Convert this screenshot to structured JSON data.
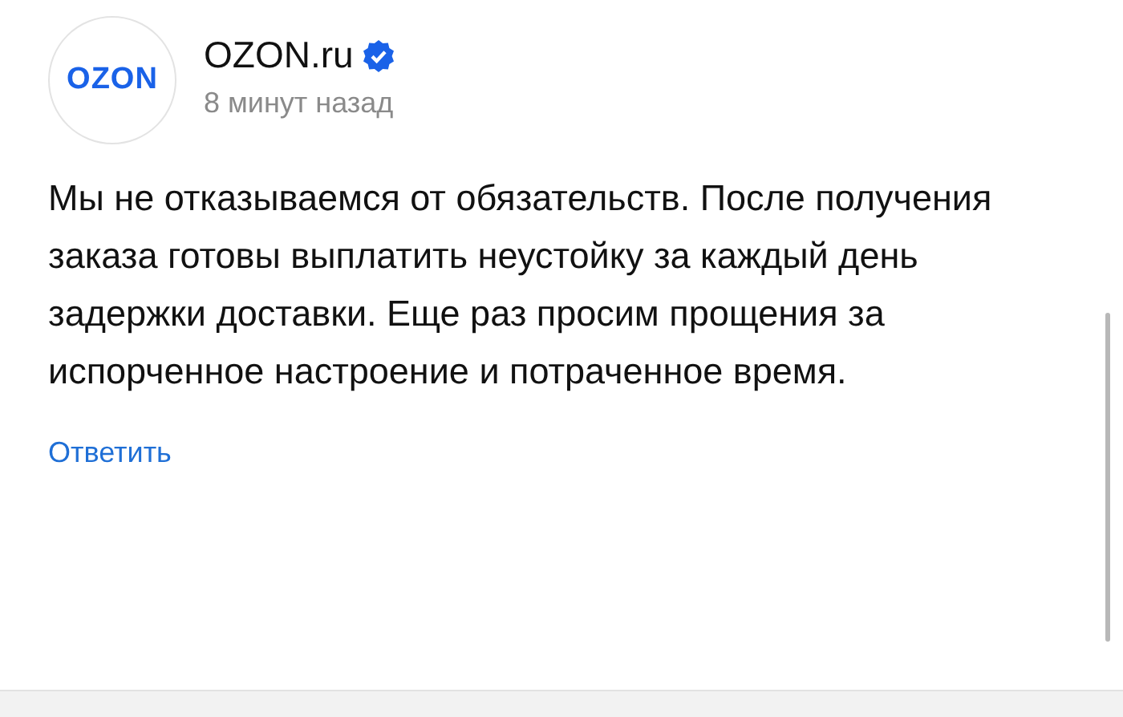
{
  "post": {
    "avatar_text": "OZON",
    "author": "OZON.ru",
    "verified": true,
    "time": "8 минут назад",
    "body": "Мы не отказываемся от обязательств. После получения заказа готовы выплатить неустойку за каждый день задержки доставки. Еще раз просим прощения за испорченное настроение и потраченное время.",
    "reply": "Ответить"
  }
}
